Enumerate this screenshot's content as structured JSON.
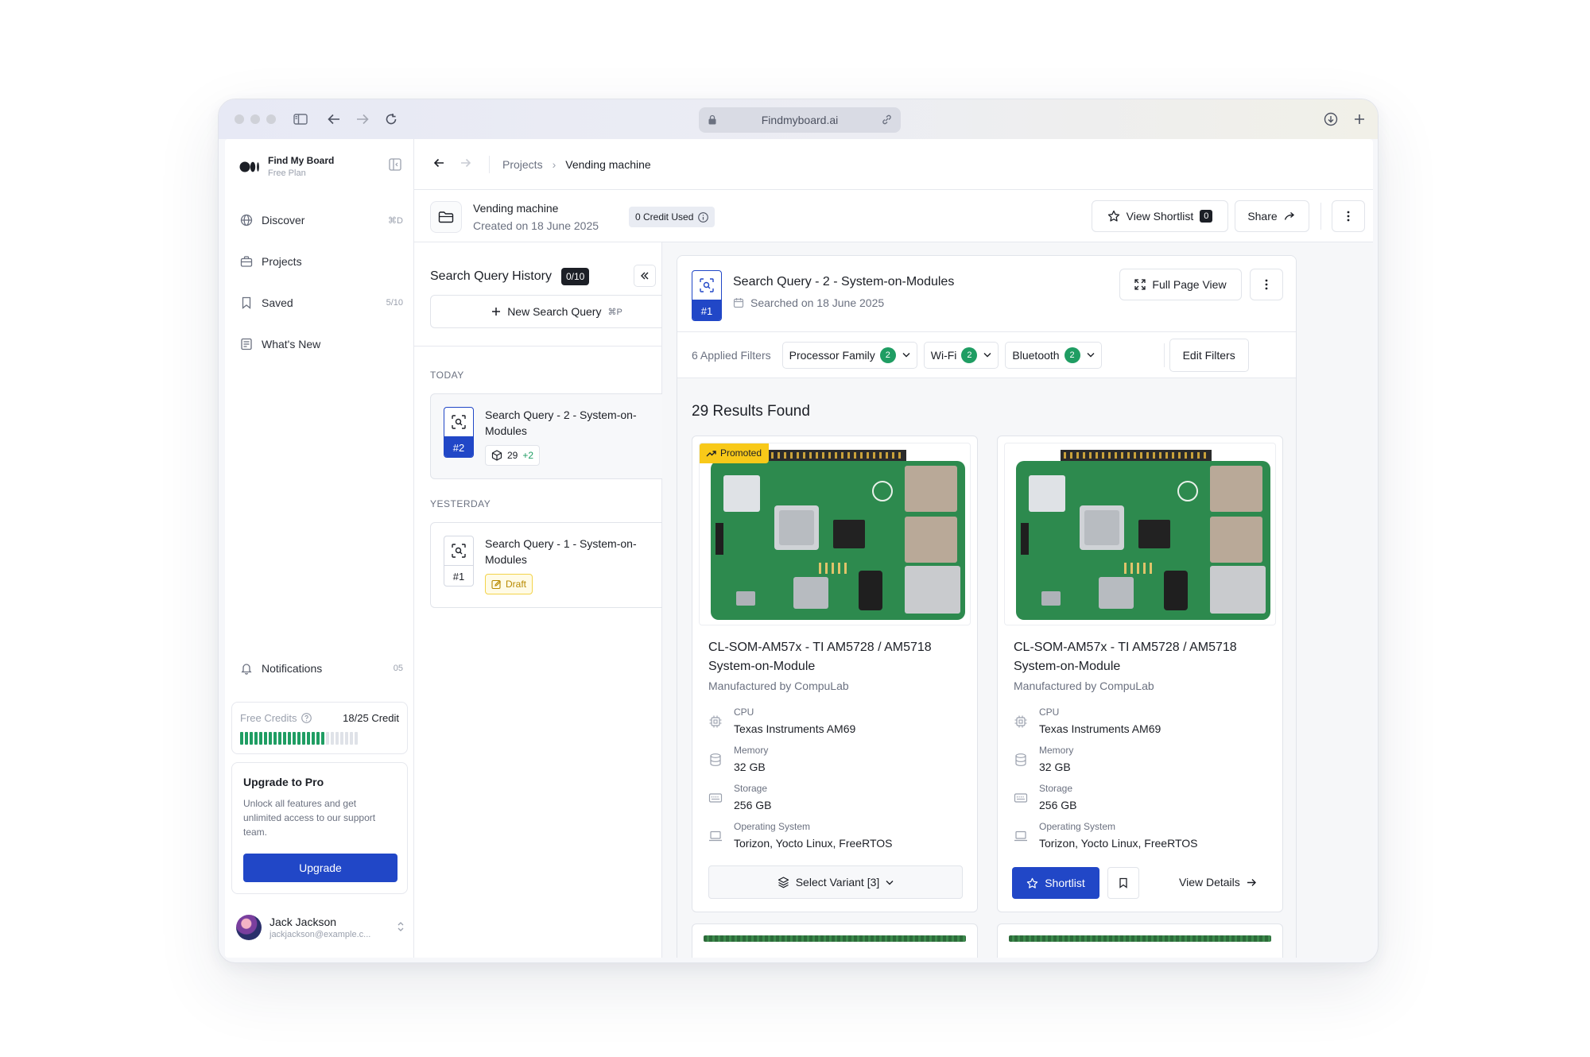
{
  "browser": {
    "url": "Findmyboard.ai"
  },
  "sidebar": {
    "brand_name": "Find My Board",
    "plan": "Free Plan",
    "nav": [
      {
        "label": "Discover",
        "meta": "⌘D",
        "icon": "globe-icon"
      },
      {
        "label": "Projects",
        "meta": "",
        "icon": "briefcase-icon"
      },
      {
        "label": "Saved",
        "meta": "5/10",
        "icon": "bookmark-icon"
      },
      {
        "label": "What's New",
        "meta": "",
        "icon": "newspaper-icon"
      }
    ],
    "notifications": {
      "label": "Notifications",
      "count": "05"
    },
    "credits": {
      "label": "Free Credits",
      "value": "18/25 Credit",
      "used": 18,
      "total": 25
    },
    "upgrade": {
      "title": "Upgrade to Pro",
      "text": "Unlock all features and get unlimited access to our support team.",
      "button": "Upgrade"
    },
    "user": {
      "name": "Jack Jackson",
      "email": "jackjackson@example.c..."
    }
  },
  "breadcrumb": {
    "parent": "Projects",
    "current": "Vending machine"
  },
  "project": {
    "title": "Vending machine",
    "created": "Created on 18 June 2025",
    "credit_used": "0 Credit Used",
    "view_shortlist": "View Shortlist",
    "shortlist_count": "0",
    "share": "Share"
  },
  "history": {
    "title": "Search Query History",
    "count": "0/10",
    "new_query": "New Search Query",
    "new_query_shortcut": "⌘P",
    "today_label": "TODAY",
    "yesterday_label": "YESTERDAY",
    "items": [
      {
        "num": "#2",
        "title": "Search Query - 2 - System-on-Modules",
        "results": "29",
        "delta": "+2"
      },
      {
        "num": "#1",
        "title": "Search Query - 1 - System-on-Modules",
        "status": "Draft"
      }
    ]
  },
  "query": {
    "num": "#1",
    "title": "Search Query - 2 - System-on-Modules",
    "searched": "Searched on 18 June 2025",
    "full_page": "Full Page View",
    "applied_filters": "6 Applied Filters",
    "filters": [
      {
        "label": "Processor Family",
        "count": "2"
      },
      {
        "label": "Wi-Fi",
        "count": "2"
      },
      {
        "label": "Bluetooth",
        "count": "2"
      }
    ],
    "edit_filters": "Edit Filters",
    "results_found": "29 Results Found"
  },
  "products": [
    {
      "promoted": "Promoted",
      "name": "CL-SOM-AM57x - TI AM5728 / AM5718 System-on-Module",
      "manufacturer": "Manufactured by CompuLab",
      "specs": [
        {
          "key": "CPU",
          "value": "Texas Instruments AM69",
          "icon": "cpu-icon"
        },
        {
          "key": "Memory",
          "value": "32 GB",
          "icon": "database-icon"
        },
        {
          "key": "Storage",
          "value": "256 GB",
          "icon": "storage-icon"
        },
        {
          "key": "Operating System",
          "value": "Torizon, Yocto Linux, FreeRTOS",
          "icon": "laptop-icon"
        }
      ],
      "variant_button": "Select Variant [3]"
    },
    {
      "name": "CL-SOM-AM57x - TI AM5728 / AM5718 System-on-Module",
      "manufacturer": "Manufactured by CompuLab",
      "specs": [
        {
          "key": "CPU",
          "value": "Texas Instruments AM69",
          "icon": "cpu-icon"
        },
        {
          "key": "Memory",
          "value": "32 GB",
          "icon": "database-icon"
        },
        {
          "key": "Storage",
          "value": "256 GB",
          "icon": "storage-icon"
        },
        {
          "key": "Operating System",
          "value": "Torizon, Yocto Linux, FreeRTOS",
          "icon": "laptop-icon"
        }
      ],
      "shortlist_button": "Shortlist",
      "details_link": "View Details"
    }
  ],
  "colors": {
    "accent": "#2147c7",
    "success": "#1f9d63",
    "promo": "#f8c919",
    "dark": "#1c1f26"
  }
}
